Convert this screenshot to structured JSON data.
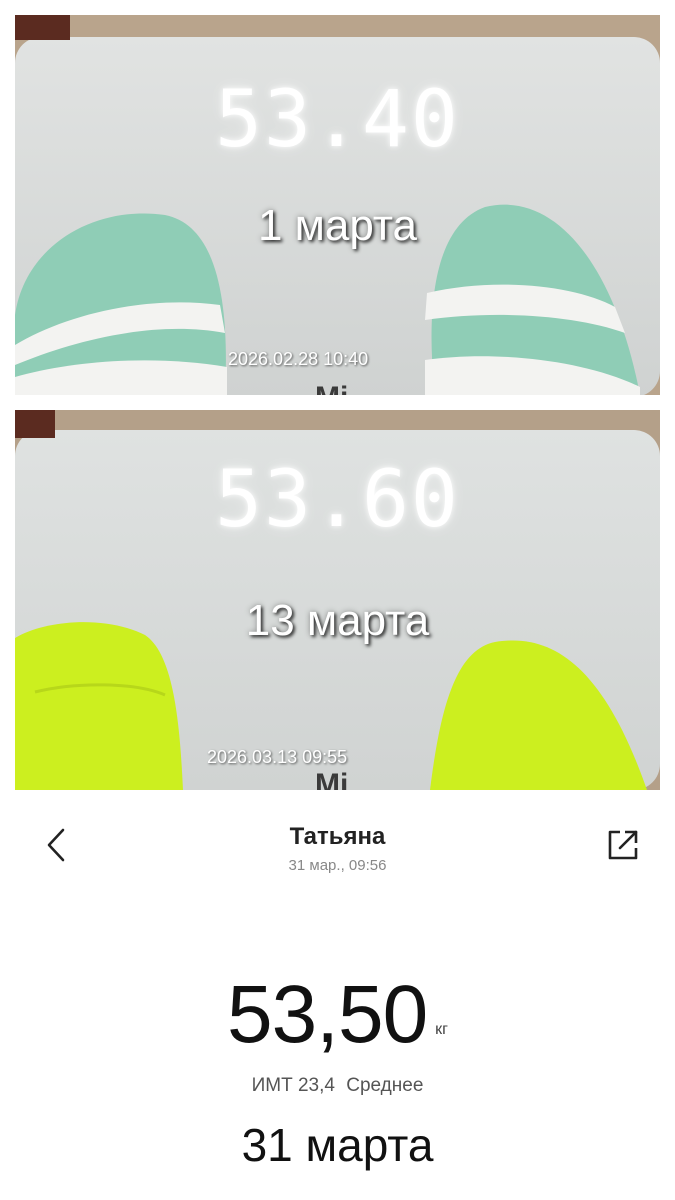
{
  "photos": [
    {
      "scale_reading": "53.40",
      "caption": "1 марта",
      "timestamp": "2026.02.28 10:40",
      "sock_color": "#8fcdb6",
      "sock_stripe_color": "#f3f3f1"
    },
    {
      "scale_reading": "53.60",
      "caption": "13 марта",
      "timestamp": "2026.03.13 09:55",
      "sock_color": "#ccef1f"
    }
  ],
  "header": {
    "back_icon": "chevron-left-icon",
    "title": "Татьяна",
    "subtitle": "31 мар., 09:56",
    "share_icon": "share-icon"
  },
  "measurement": {
    "weight": "53,50",
    "unit": "кг",
    "bmi_label": "ИМТ 23,4",
    "bmi_status": "Среднее"
  },
  "caption": "31 марта",
  "colors": {
    "scale_surface": "#d9dcdb",
    "text_primary": "#111111",
    "text_secondary": "#888888"
  }
}
